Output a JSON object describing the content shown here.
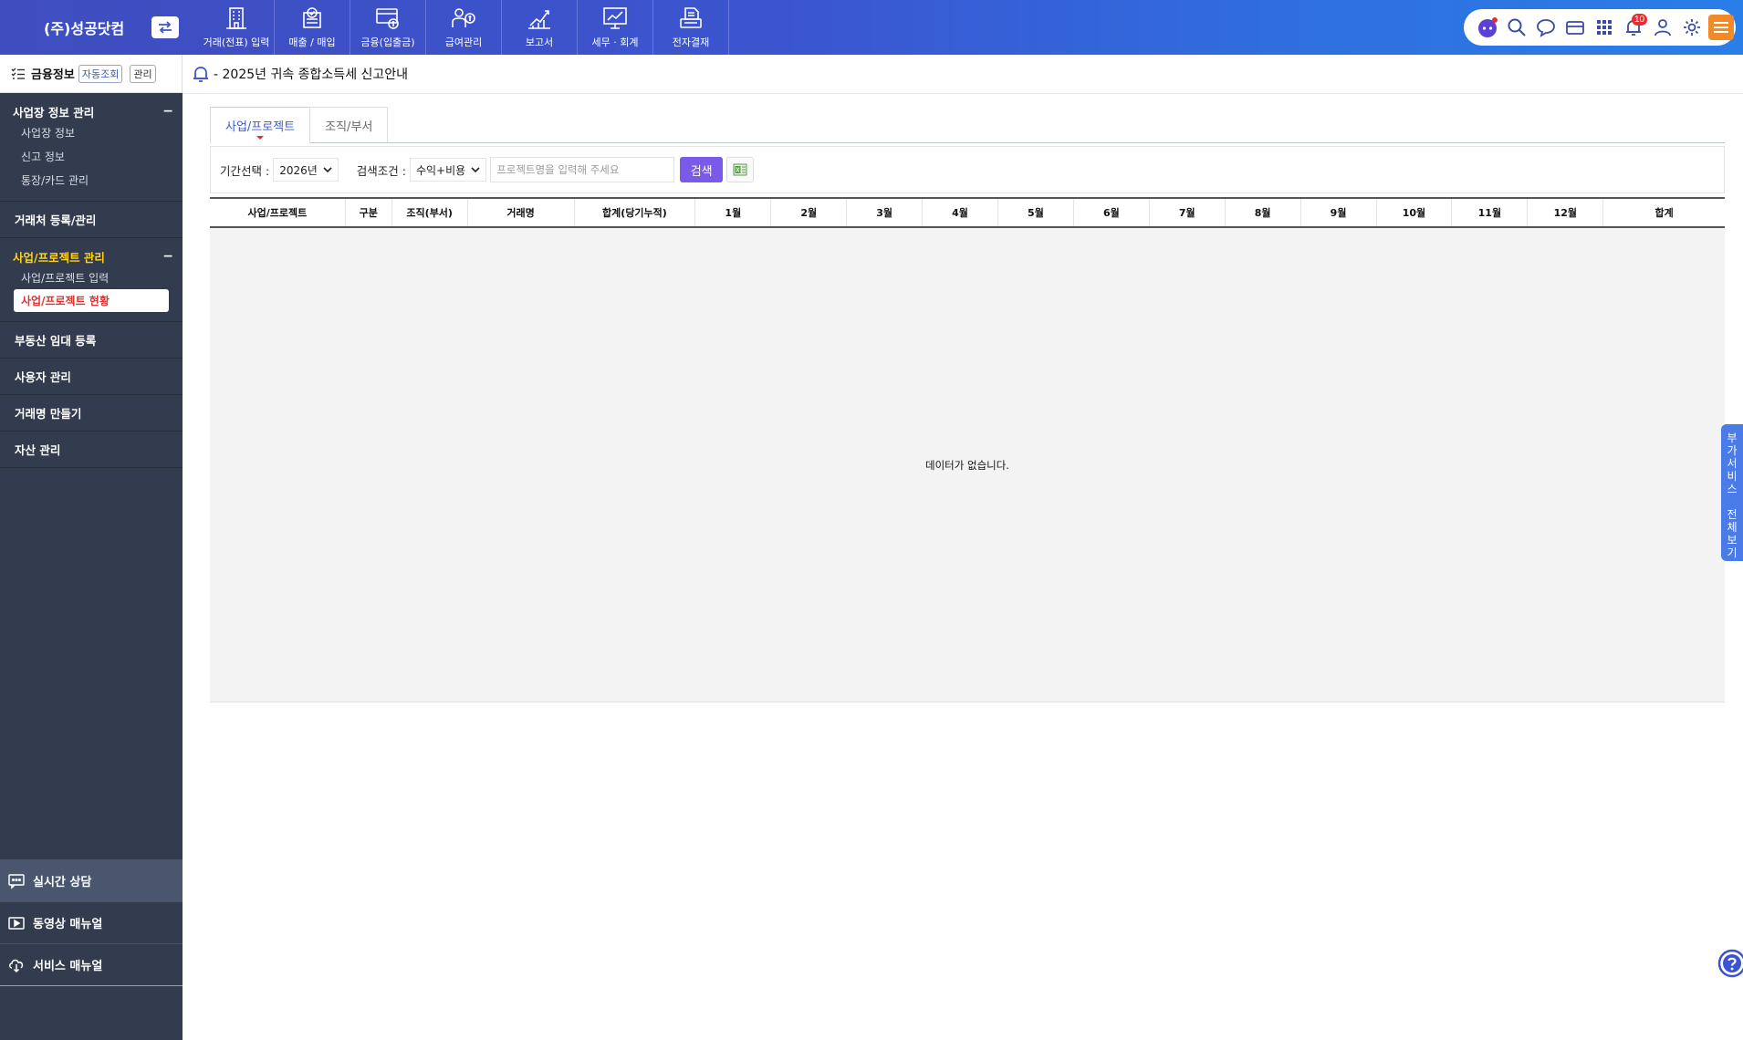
{
  "header": {
    "company": "(주)성공닷컴",
    "nav": [
      {
        "label": "거래(전표) 입력",
        "icon": "building-icon"
      },
      {
        "label": "매출 / 매입",
        "icon": "receipt-check-icon"
      },
      {
        "label": "금융(입출금)",
        "icon": "card-coin-icon"
      },
      {
        "label": "급여관리",
        "icon": "person-dollar-icon"
      },
      {
        "label": "보고서",
        "icon": "chart-up-icon"
      },
      {
        "label": "세무 · 회계",
        "icon": "presentation-icon"
      },
      {
        "label": "전자결재",
        "icon": "printer-doc-icon"
      }
    ],
    "notification_count": "10",
    "colors": {
      "brand_start": "#3f4dbf",
      "brand_end": "#2a7ee8",
      "menu_orange": "#f28a2a"
    }
  },
  "sidebar": {
    "title": "금융정보",
    "chip_auto": "자동조회",
    "chip_manage": "관리",
    "sections": [
      {
        "title": "사업장 정보 관리",
        "items": [
          "사업장 정보",
          "신고 정보",
          "통장/카드 관리"
        ]
      },
      {
        "title": "사업/프로젝트 관리",
        "items": [
          "사업/프로젝트 입력",
          "사업/프로젝트 현황"
        ]
      }
    ],
    "single_items": [
      "거래처 등록/관리",
      "부동산 임대 등록",
      "사용자 관리",
      "거래명 만들기",
      "자산 관리"
    ],
    "bottom": [
      "실시간 상담",
      "동영상 매뉴얼",
      "서비스 매뉴얼"
    ]
  },
  "notice": {
    "text": "- 2025년 귀속 종합소득세 신고안내"
  },
  "tabs": {
    "active": "사업/프로젝트",
    "other": "조직/부서"
  },
  "filter": {
    "period_label": "기간선택 :",
    "period_value": "2026년",
    "cond_label": "검색조건 :",
    "cond_value": "수익+비용",
    "search_placeholder": "프로젝트명을 입력해 주세요",
    "search_button": "검색"
  },
  "grid": {
    "columns": [
      "사업/프로젝트",
      "구분",
      "조직(부서)",
      "거래명",
      "합계(당기누적)",
      "1월",
      "2월",
      "3월",
      "4월",
      "5월",
      "6월",
      "7월",
      "8월",
      "9월",
      "10월",
      "11월",
      "12월",
      "합계"
    ],
    "empty_message": "데이터가 없습니다."
  },
  "side_tab": {
    "text": [
      "부",
      "가",
      "서",
      "비",
      "스",
      "",
      "전",
      "체",
      "보",
      "기"
    ]
  },
  "accent": {
    "search_button": "#7a5ae8",
    "active_tab": "#3b5bd0",
    "selected_item": "#e03030",
    "active_section": "#ffd21a"
  }
}
